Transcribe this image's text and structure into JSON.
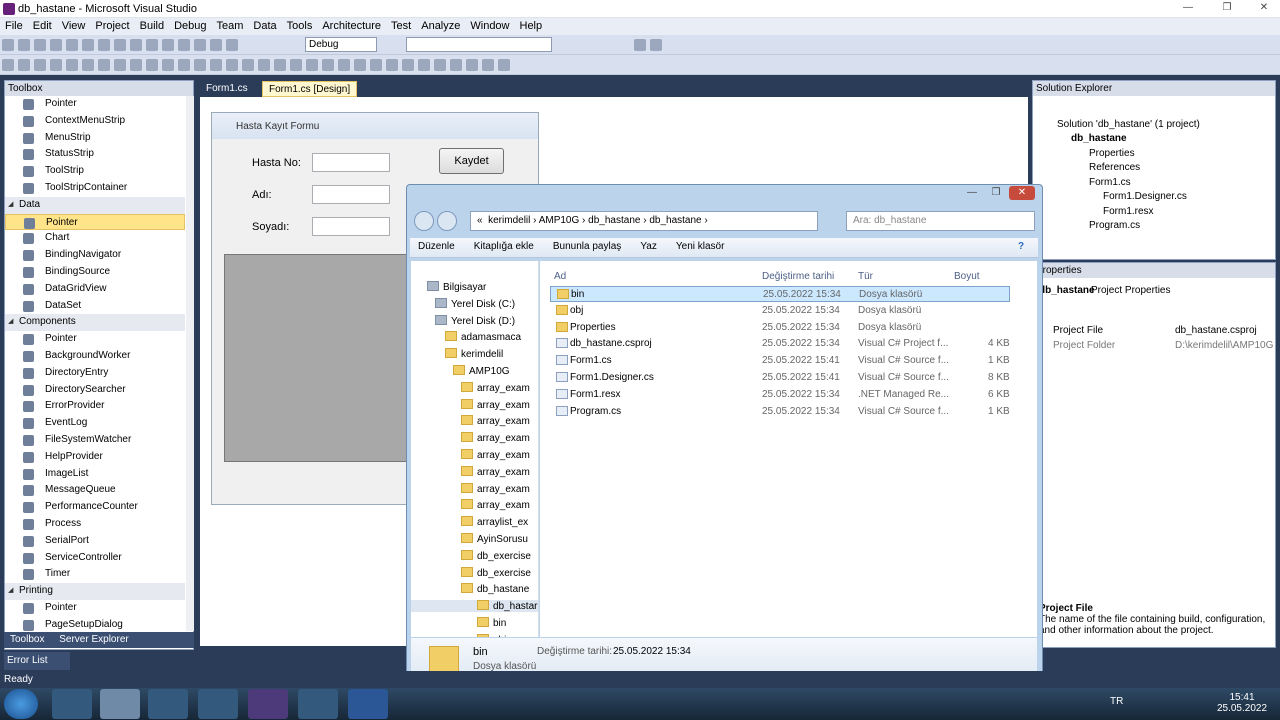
{
  "window": {
    "title": "db_hastane - Microsoft Visual Studio"
  },
  "menu": [
    "File",
    "Edit",
    "View",
    "Project",
    "Build",
    "Debug",
    "Team",
    "Data",
    "Tools",
    "Architecture",
    "Test",
    "Analyze",
    "Window",
    "Help"
  ],
  "toolbar": {
    "config": "Debug",
    "search": ""
  },
  "toolbox": {
    "title": "Toolbox",
    "rows": [
      {
        "type": "item",
        "label": "Pointer"
      },
      {
        "type": "item",
        "label": "ContextMenuStrip"
      },
      {
        "type": "item",
        "label": "MenuStrip"
      },
      {
        "type": "item",
        "label": "StatusStrip"
      },
      {
        "type": "item",
        "label": "ToolStrip"
      },
      {
        "type": "item",
        "label": "ToolStripContainer"
      },
      {
        "type": "cat",
        "label": "Data"
      },
      {
        "type": "item",
        "label": "Pointer",
        "selected": true
      },
      {
        "type": "item",
        "label": "Chart"
      },
      {
        "type": "item",
        "label": "BindingNavigator"
      },
      {
        "type": "item",
        "label": "BindingSource"
      },
      {
        "type": "item",
        "label": "DataGridView"
      },
      {
        "type": "item",
        "label": "DataSet"
      },
      {
        "type": "cat",
        "label": "Components"
      },
      {
        "type": "item",
        "label": "Pointer"
      },
      {
        "type": "item",
        "label": "BackgroundWorker"
      },
      {
        "type": "item",
        "label": "DirectoryEntry"
      },
      {
        "type": "item",
        "label": "DirectorySearcher"
      },
      {
        "type": "item",
        "label": "ErrorProvider"
      },
      {
        "type": "item",
        "label": "EventLog"
      },
      {
        "type": "item",
        "label": "FileSystemWatcher"
      },
      {
        "type": "item",
        "label": "HelpProvider"
      },
      {
        "type": "item",
        "label": "ImageList"
      },
      {
        "type": "item",
        "label": "MessageQueue"
      },
      {
        "type": "item",
        "label": "PerformanceCounter"
      },
      {
        "type": "item",
        "label": "Process"
      },
      {
        "type": "item",
        "label": "SerialPort"
      },
      {
        "type": "item",
        "label": "ServiceController"
      },
      {
        "type": "item",
        "label": "Timer"
      },
      {
        "type": "cat",
        "label": "Printing"
      },
      {
        "type": "item",
        "label": "Pointer"
      },
      {
        "type": "item",
        "label": "PageSetupDialog"
      }
    ],
    "tabs": [
      "Toolbox",
      "Server Explorer"
    ]
  },
  "doc_tabs": [
    "Form1.cs",
    "Form1.cs [Design]"
  ],
  "form": {
    "title": "Hasta Kayıt Formu",
    "labels": [
      "Hasta No:",
      "Adı:",
      "Soyadı:"
    ],
    "button": "Kaydet"
  },
  "solution_explorer": {
    "title": "Solution Explorer",
    "nodes": [
      "Solution 'db_hastane' (1 project)",
      "db_hastane",
      "Properties",
      "References",
      "Form1.cs",
      "Form1.Designer.cs",
      "Form1.resx",
      "Program.cs"
    ]
  },
  "properties": {
    "title": "Properties",
    "object": "db_hastane",
    "object_type": "Project Properties",
    "rows": [
      {
        "name": "Project File",
        "value": "db_hastane.csproj"
      },
      {
        "name": "Project Folder",
        "value": "D:\\kerimdelil\\AMP10G"
      }
    ],
    "desc_title": "Project File",
    "desc_text": "The name of the file containing build, configuration, and other information about the project."
  },
  "explorer": {
    "breadcrumb": [
      "kerimdelil",
      "AMP10G",
      "db_hastane",
      "db_hastane"
    ],
    "search_placeholder": "Ara: db_hastane",
    "commands": [
      "Düzenle",
      "Kitaplığa ekle",
      "Bununla paylaş",
      "Yaz",
      "Yeni klasör"
    ],
    "columns": [
      "Ad",
      "Değiştirme tarihi",
      "Tür",
      "Boyut"
    ],
    "nav": [
      "Bilgisayar",
      "Yerel Disk (C:)",
      "Yerel Disk (D:)",
      "adamasmaca",
      "kerimdelil",
      "AMP10G",
      "array_exam",
      "array_exam",
      "array_exam",
      "array_exam",
      "array_exam",
      "array_exam",
      "array_exam",
      "array_exam",
      "arraylist_ex",
      "AyinSorusu",
      "db_exercise",
      "db_exercise",
      "db_hastane",
      "db_hastar",
      "bin",
      "obj"
    ],
    "files": [
      {
        "name": "bin",
        "date": "25.05.2022 15:34",
        "type": "Dosya klasörü",
        "size": ""
      },
      {
        "name": "obj",
        "date": "25.05.2022 15:34",
        "type": "Dosya klasörü",
        "size": ""
      },
      {
        "name": "Properties",
        "date": "25.05.2022 15:34",
        "type": "Dosya klasörü",
        "size": ""
      },
      {
        "name": "db_hastane.csproj",
        "date": "25.05.2022 15:34",
        "type": "Visual C# Project f...",
        "size": "4 KB"
      },
      {
        "name": "Form1.cs",
        "date": "25.05.2022 15:41",
        "type": "Visual C# Source f...",
        "size": "1 KB"
      },
      {
        "name": "Form1.Designer.cs",
        "date": "25.05.2022 15:41",
        "type": "Visual C# Source f...",
        "size": "8 KB"
      },
      {
        "name": "Form1.resx",
        "date": "25.05.2022 15:34",
        "type": ".NET Managed Re...",
        "size": "6 KB"
      },
      {
        "name": "Program.cs",
        "date": "25.05.2022 15:34",
        "type": "Visual C# Source f...",
        "size": "1 KB"
      }
    ],
    "details": {
      "name": "bin",
      "type": "Dosya klasörü",
      "date_label": "Değiştirme tarihi:",
      "date": "25.05.2022 15:34"
    }
  },
  "error_list": "Error List",
  "status": "Ready",
  "tray": {
    "lang": "TR",
    "time": "15:41",
    "date": "25.05.2022"
  }
}
